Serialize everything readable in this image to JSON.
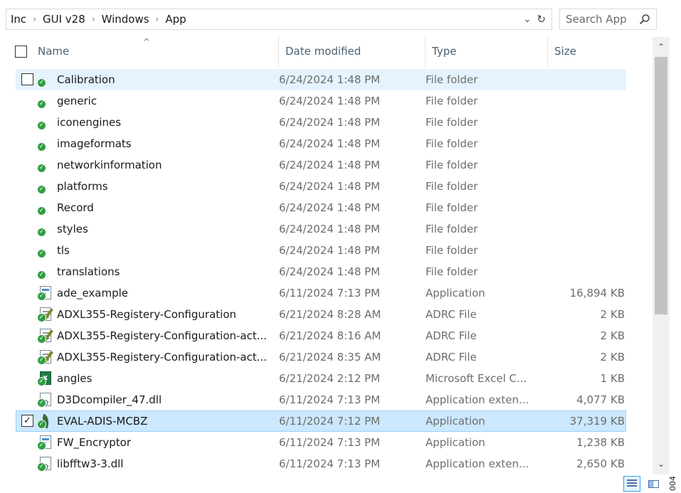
{
  "breadcrumb": [
    "Inc",
    "GUI v28",
    "Windows",
    "App"
  ],
  "search": {
    "placeholder": "Search App"
  },
  "columns": {
    "name": "Name",
    "date": "Date modified",
    "type": "Type",
    "size": "Size"
  },
  "rows": [
    {
      "name": "Calibration",
      "date": "6/24/2024 1:48 PM",
      "type": "File folder",
      "size": "",
      "icon": "folder-icon",
      "state": "hover",
      "checkbox": "unchecked"
    },
    {
      "name": "generic",
      "date": "6/24/2024 1:48 PM",
      "type": "File folder",
      "size": "",
      "icon": "folder-icon"
    },
    {
      "name": "iconengines",
      "date": "6/24/2024 1:48 PM",
      "type": "File folder",
      "size": "",
      "icon": "folder-icon"
    },
    {
      "name": "imageformats",
      "date": "6/24/2024 1:48 PM",
      "type": "File folder",
      "size": "",
      "icon": "folder-icon"
    },
    {
      "name": "networkinformation",
      "date": "6/24/2024 1:48 PM",
      "type": "File folder",
      "size": "",
      "icon": "folder-icon"
    },
    {
      "name": "platforms",
      "date": "6/24/2024 1:48 PM",
      "type": "File folder",
      "size": "",
      "icon": "folder-icon"
    },
    {
      "name": "Record",
      "date": "6/24/2024 1:48 PM",
      "type": "File folder",
      "size": "",
      "icon": "folder-icon"
    },
    {
      "name": "styles",
      "date": "6/24/2024 1:48 PM",
      "type": "File folder",
      "size": "",
      "icon": "folder-icon"
    },
    {
      "name": "tls",
      "date": "6/24/2024 1:48 PM",
      "type": "File folder",
      "size": "",
      "icon": "folder-icon"
    },
    {
      "name": "translations",
      "date": "6/24/2024 1:48 PM",
      "type": "File folder",
      "size": "",
      "icon": "folder-icon"
    },
    {
      "name": "ade_example",
      "date": "6/11/2024 7:13 PM",
      "type": "Application",
      "size": "16,894 KB",
      "icon": "application-icon"
    },
    {
      "name": "ADXL355-Registery-Configuration",
      "date": "6/21/2024 8:28 AM",
      "type": "ADRC File",
      "size": "2 KB",
      "icon": "adrc-file-icon"
    },
    {
      "name": "ADXL355-Registery-Configuration-act...",
      "date": "6/21/2024 8:16 AM",
      "type": "ADRC File",
      "size": "2 KB",
      "icon": "adrc-file-icon"
    },
    {
      "name": "ADXL355-Registery-Configuration-act...",
      "date": "6/21/2024 8:35 AM",
      "type": "ADRC File",
      "size": "2 KB",
      "icon": "adrc-file-icon"
    },
    {
      "name": "angles",
      "date": "6/21/2024 2:12 PM",
      "type": "Microsoft Excel C...",
      "size": "1 KB",
      "icon": "excel-file-icon"
    },
    {
      "name": "D3Dcompiler_47.dll",
      "date": "6/11/2024 7:13 PM",
      "type": "Application exten...",
      "size": "4,077 KB",
      "icon": "dll-file-icon"
    },
    {
      "name": "EVAL-ADIS-MCBZ",
      "date": "6/11/2024 7:12 PM",
      "type": "Application",
      "size": "37,319 KB",
      "icon": "eval-app-icon",
      "state": "selected",
      "checkbox": "checked"
    },
    {
      "name": "FW_Encryptor",
      "date": "6/11/2024 7:13 PM",
      "type": "Application",
      "size": "1,238 KB",
      "icon": "application-icon"
    },
    {
      "name": "libfftw3-3.dll",
      "date": "6/11/2024 7:13 PM",
      "type": "Application exten...",
      "size": "2,650 KB",
      "icon": "dll-file-icon"
    }
  ],
  "figure_number": "004"
}
